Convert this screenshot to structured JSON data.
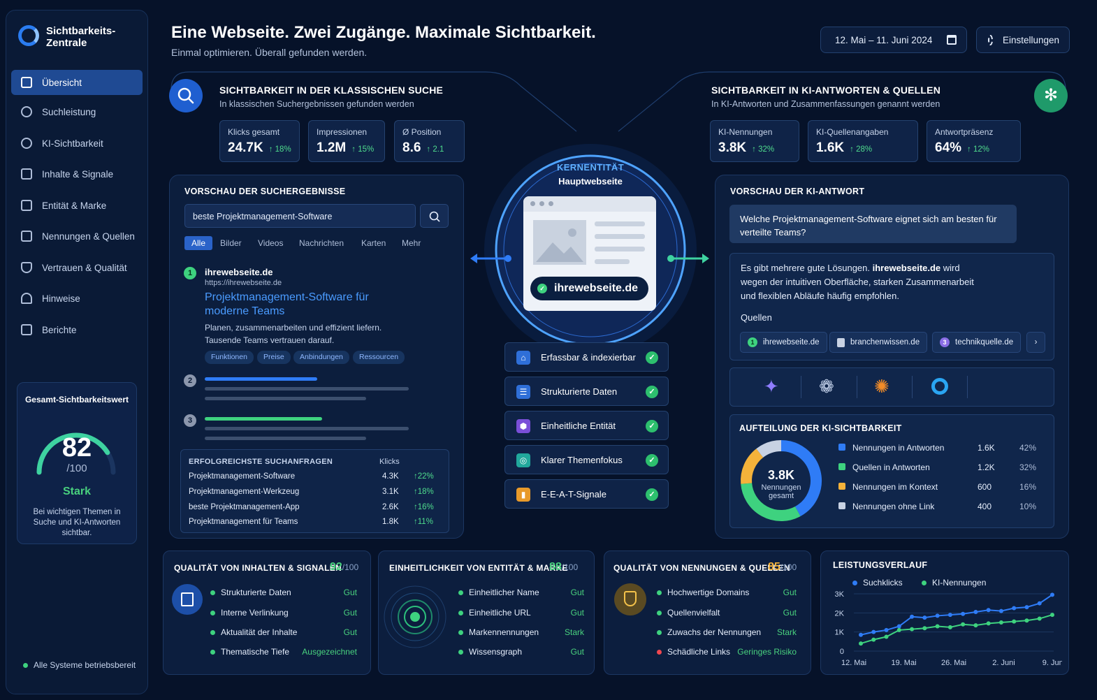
{
  "sidebar": {
    "brand": "Sichtbarkeits-\nZentrale",
    "items": [
      {
        "label": "Übersicht",
        "icon": "dashboard-icon"
      },
      {
        "label": "Suchleistung",
        "icon": "search-chart-icon"
      },
      {
        "label": "KI-Sichtbarkeit",
        "icon": "ai-gear-icon"
      },
      {
        "label": "Inhalte & Signale",
        "icon": "document-icon"
      },
      {
        "label": "Entität & Marke",
        "icon": "entity-icon"
      },
      {
        "label": "Nennungen & Quellen",
        "icon": "list-icon"
      },
      {
        "label": "Vertrauen & Qualität",
        "icon": "shield-icon"
      },
      {
        "label": "Hinweise",
        "icon": "bell-icon"
      },
      {
        "label": "Berichte",
        "icon": "report-icon"
      }
    ],
    "score": {
      "title": "Gesamt-Sichtbarkeitswert",
      "value": "82",
      "max": "/100",
      "level": 0.82,
      "rating": "Stark",
      "desc": "Bei wichtigen Themen in Suche und KI-Antworten sichtbar."
    },
    "status": "Alle Systeme betriebsbereit"
  },
  "header": {
    "title": "Eine Webseite. Zwei Zugänge. Maximale Sichtbarkeit.",
    "subtitle": "Einmal optimieren. Überall gefunden werden.",
    "date_range": "12. Mai – 11. Juni 2024",
    "settings": "Einstellungen"
  },
  "search": {
    "title": "SICHTBARKEIT IN DER KLASSISCHEN SUCHE",
    "subtitle": "In klassischen Suchergebnissen gefunden werden",
    "metrics": [
      {
        "label": "Klicks gesamt",
        "value": "24.7K",
        "delta": "18%"
      },
      {
        "label": "Impressionen",
        "value": "1.2M",
        "delta": "15%"
      },
      {
        "label": "Ø Position",
        "value": "8.6",
        "delta": "2.1"
      }
    ],
    "preview_title": "VORSCHAU DER SUCHERGEBNISSE",
    "query": "beste Projektmanagement-Software",
    "tabs": [
      "Alle",
      "Bilder",
      "Videos",
      "Nachrichten",
      "Karten",
      "Mehr"
    ],
    "result": {
      "rank": "1",
      "domain": "ihrewebseite.de",
      "url": "https://ihrewebseite.de",
      "title": "Projektmanagement-Software für moderne Teams",
      "desc": "Planen, zusammenarbeiten und effizient liefern. Tausende Teams vertrauen darauf.",
      "links": [
        "Funktionen",
        "Preise",
        "Anbindungen",
        "Ressourcen"
      ]
    },
    "rank2": "2",
    "rank3": "3",
    "top_queries": {
      "title": "ERFOLGREICHSTE SUCHANFRAGEN",
      "col": "Klicks",
      "rows": [
        {
          "q": "Projektmanagement-Software",
          "v": "4.3K",
          "d": "22%"
        },
        {
          "q": "Projektmanagement-Werkzeug",
          "v": "3.1K",
          "d": "18%"
        },
        {
          "q": "beste Projektmanagement-App",
          "v": "2.6K",
          "d": "16%"
        },
        {
          "q": "Projektmanagement für Teams",
          "v": "1.8K",
          "d": "11%"
        }
      ]
    }
  },
  "core": {
    "label": "KERNENTITÄT",
    "sub": "Hauptwebseite",
    "domain": "ihrewebseite.de",
    "checks": [
      "Erfassbar & indexierbar",
      "Strukturierte Daten",
      "Einheitliche Entität",
      "Klarer Themenfokus",
      "E-E-A-T-Signale"
    ]
  },
  "ai": {
    "title": "SICHTBARKEIT IN KI-ANTWORTEN & QUELLEN",
    "subtitle": "In KI-Antworten und Zusammenfassungen genannt werden",
    "metrics": [
      {
        "label": "KI-Nennungen",
        "value": "3.8K",
        "delta": "32%"
      },
      {
        "label": "KI-Quellenangaben",
        "value": "1.6K",
        "delta": "28%"
      },
      {
        "label": "Antwortpräsenz",
        "value": "64%",
        "delta": "12%"
      }
    ],
    "preview_title": "VORSCHAU DER KI-ANTWORT",
    "question": "Welche Projektmanagement-Software eignet sich am besten für verteilte Teams?",
    "answer_pre": "Es gibt mehrere gute Lösungen. ",
    "answer_brand": "ihrewebseite.de",
    "answer_post": " wird wegen der intuitiven Oberfläche, starken Zusammenarbeit und flexiblen Abläufe häufig empfohlen.",
    "sources_label": "Quellen",
    "sources": [
      {
        "n": "1",
        "name": "ihrewebseite.de"
      },
      {
        "n": "",
        "name": "branchenwissen.de"
      },
      {
        "n": "3",
        "name": "technikquelle.de"
      }
    ],
    "split": {
      "title": "AUFTEILUNG DER KI-SICHTBARKEIT",
      "total": "3.8K",
      "total_label": "Nennungen gesamt"
    }
  },
  "chart_data": [
    {
      "type": "pie",
      "title": "AUFTEILUNG DER KI-SICHTBARKEIT",
      "categories": [
        "Nennungen in Antworten",
        "Quellen in Antworten",
        "Nennungen im Kontext",
        "Nennungen ohne Link"
      ],
      "values": [
        1600,
        1200,
        600,
        400
      ],
      "display_values": [
        "1.6K",
        "1.2K",
        "600",
        "400"
      ],
      "percent": [
        "42%",
        "32%",
        "16%",
        "10%"
      ],
      "colors": [
        "#2f7cf6",
        "#3ed27f",
        "#f4b23a",
        "#c8d2e3"
      ]
    },
    {
      "type": "line",
      "title": "LEISTUNGSVERLAUF",
      "x_ticks": [
        "12. Mai",
        "19. Mai",
        "26. Mai",
        "2. Juni",
        "9. Juni"
      ],
      "y_ticks": [
        "0",
        "1K",
        "2K",
        "3K"
      ],
      "ylim": [
        0,
        3000
      ],
      "series": [
        {
          "name": "Suchklicks",
          "color": "#2f7cf6",
          "values": [
            850,
            1000,
            1100,
            1300,
            1800,
            1750,
            1850,
            1900,
            1950,
            2050,
            2150,
            2100,
            2250,
            2300,
            2500,
            2950
          ]
        },
        {
          "name": "KI-Nennungen",
          "color": "#3ed27f",
          "values": [
            400,
            600,
            750,
            1100,
            1150,
            1200,
            1300,
            1250,
            1400,
            1350,
            1450,
            1500,
            1550,
            1600,
            1700,
            1900
          ]
        }
      ]
    }
  ],
  "bottom": {
    "content": {
      "title": "QUALITÄT VON INHALTEN & SIGNALEN",
      "score": "92",
      "max": "/100",
      "rows": [
        [
          "Strukturierte Daten",
          "Gut"
        ],
        [
          "Interne Verlinkung",
          "Gut"
        ],
        [
          "Aktualität der Inhalte",
          "Gut"
        ],
        [
          "Thematische Tiefe",
          "Ausgezeichnet"
        ]
      ]
    },
    "entity": {
      "title": "EINHEITLICHKEIT VON ENTITÄT & MARKE",
      "score": "88",
      "max": "/100",
      "rows": [
        [
          "Einheitlicher Name",
          "Gut"
        ],
        [
          "Einheitliche URL",
          "Gut"
        ],
        [
          "Markennennungen",
          "Stark"
        ],
        [
          "Wissensgraph",
          "Gut"
        ]
      ]
    },
    "mentions": {
      "title": "QUALITÄT VON NENNUNGEN & QUELLEN",
      "score": "85",
      "max": "/100",
      "rows": [
        [
          "Hochwertige Domains",
          "Gut"
        ],
        [
          "Quellenvielfalt",
          "Gut"
        ],
        [
          "Zuwachs der Nennungen",
          "Stark"
        ],
        [
          "Schädliche Links",
          "Geringes Risiko"
        ]
      ]
    },
    "trend": {
      "title": "LEISTUNGSVERLAUF"
    }
  }
}
